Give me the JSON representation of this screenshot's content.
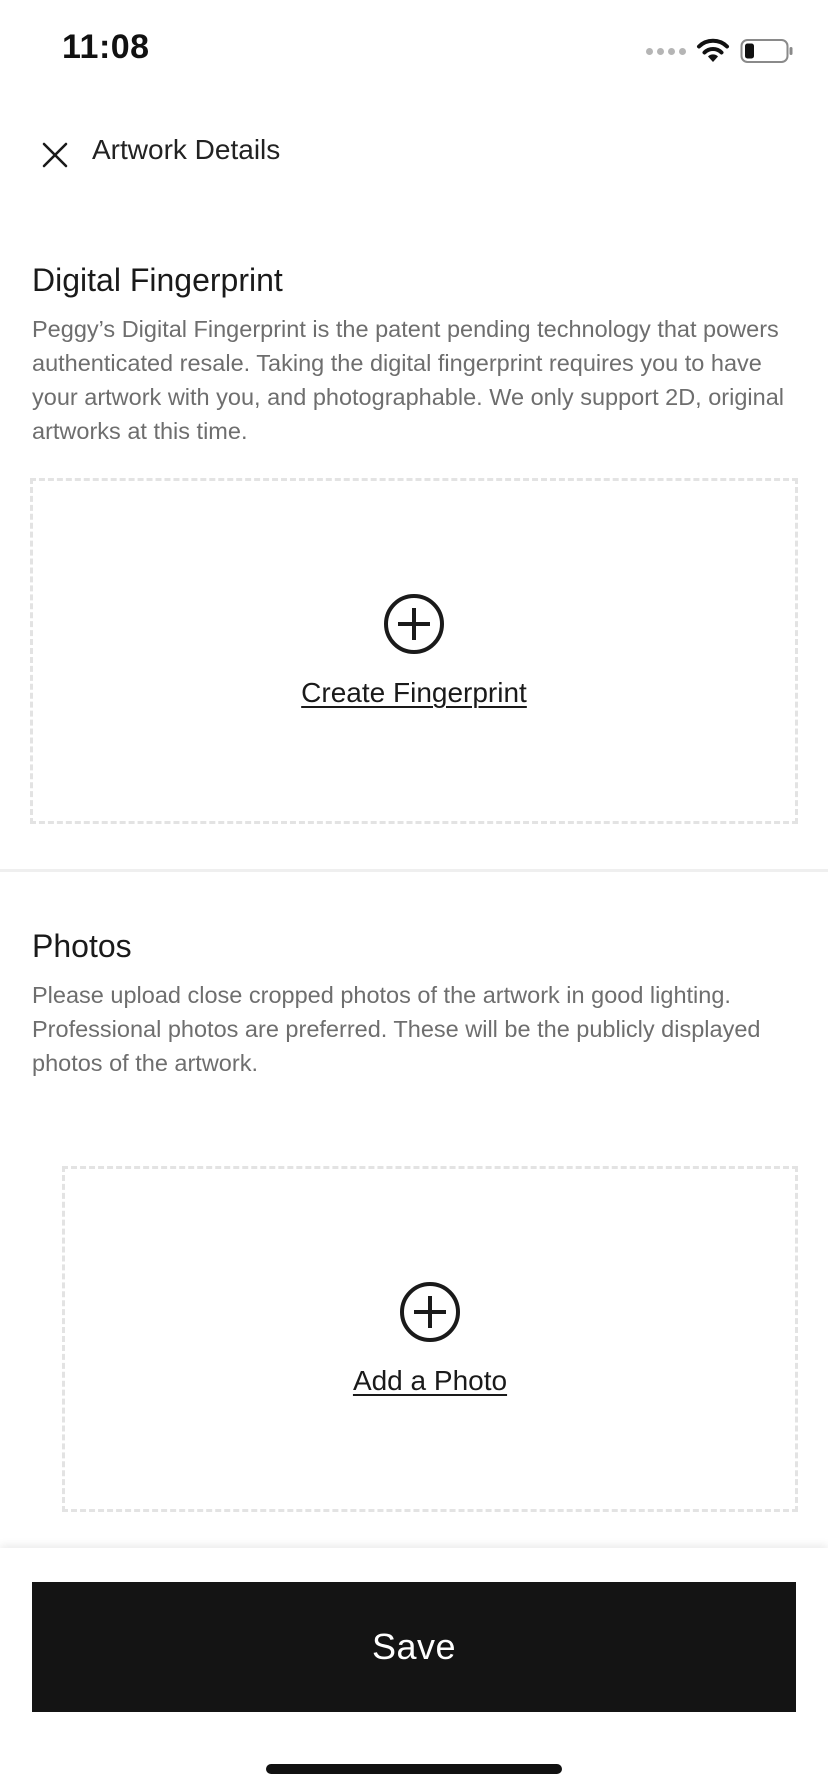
{
  "status_bar": {
    "time": "11:08",
    "icons": [
      "signal-dots-icon",
      "wifi-icon",
      "battery-icon"
    ]
  },
  "header": {
    "close_icon": "close-icon",
    "title": "Artwork Details"
  },
  "fingerprint_section": {
    "title": "Digital Fingerprint",
    "description": "Peggy’s Digital Fingerprint is the patent pending technology that powers authenticated resale. Taking the digital fingerprint requires you to have your artwork with you, and photographable. We only support 2D, original artworks at this time.",
    "action_icon": "plus-circle-icon",
    "action_label": "Create Fingerprint"
  },
  "photos_section": {
    "title": "Photos",
    "description": "Please upload close cropped photos of the artwork in good lighting. Professional photos are preferred. These will be the publicly displayed photos of the artwork.",
    "action_icon": "plus-circle-icon",
    "action_label": "Add a Photo"
  },
  "footer": {
    "save_label": "Save"
  },
  "colors": {
    "primary_button": "#141414",
    "body_text": "#6e6e6e",
    "dashed_border": "#e3e3e3",
    "divider": "#efefef"
  }
}
